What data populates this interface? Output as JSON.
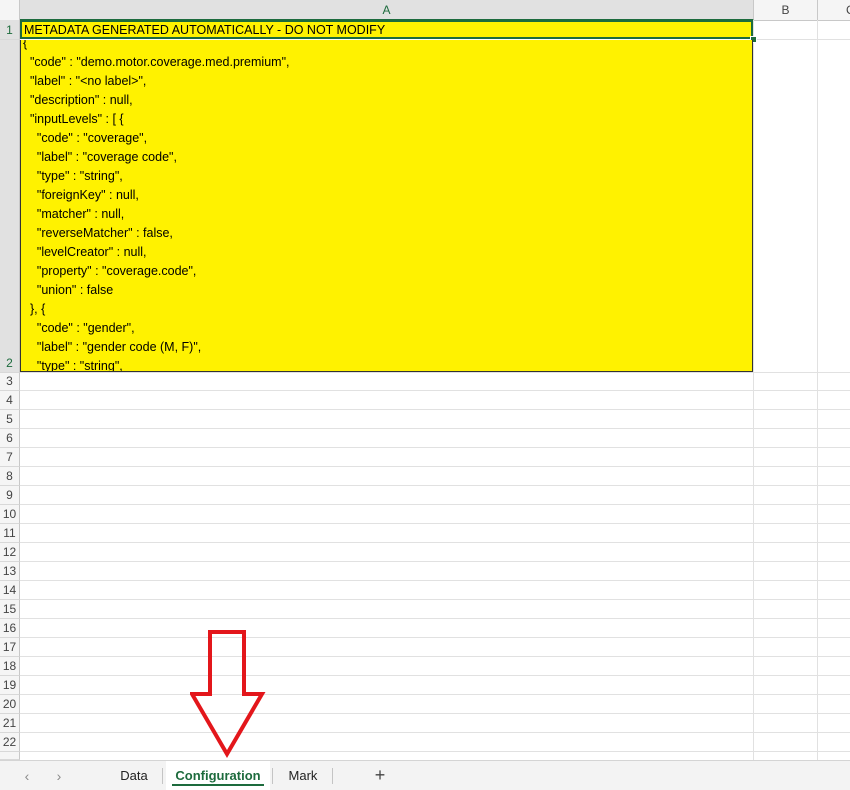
{
  "columns": [
    "A",
    "B",
    "C"
  ],
  "rows": [
    "1",
    "2",
    "3",
    "4",
    "5",
    "6",
    "7",
    "8",
    "9",
    "10",
    "11",
    "12",
    "13",
    "14",
    "15",
    "16",
    "17",
    "18",
    "19",
    "20",
    "21",
    "22"
  ],
  "cells": {
    "a1": "METADATA GENERATED AUTOMATICALLY - DO NOT MODIFY",
    "a2_lines": [
      "{",
      "  \"code\" : \"demo.motor.coverage.med.premium\",",
      "  \"label\" : \"<no label>\",",
      "  \"description\" : null,",
      "  \"inputLevels\" : [ {",
      "    \"code\" : \"coverage\",",
      "    \"label\" : \"coverage code\",",
      "    \"type\" : \"string\",",
      "    \"foreignKey\" : null,",
      "    \"matcher\" : null,",
      "    \"reverseMatcher\" : false,",
      "    \"levelCreator\" : null,",
      "    \"property\" : \"coverage.code\",",
      "    \"union\" : false",
      "  }, {",
      "    \"code\" : \"gender\",",
      "    \"label\" : \"gender code (M, F)\",",
      "    \"type\" : \"string\","
    ]
  },
  "sheet_tabs": [
    {
      "label": "Data",
      "active": false
    },
    {
      "label": "Configuration",
      "active": true
    },
    {
      "label": "Mark",
      "active": false
    }
  ],
  "nav": {
    "prev_icon": "‹",
    "next_icon": "›",
    "add_icon": "+"
  },
  "colors": {
    "cell_fill": "#fff200",
    "accent": "#1d6b3d",
    "arrow": "#e3161b"
  }
}
